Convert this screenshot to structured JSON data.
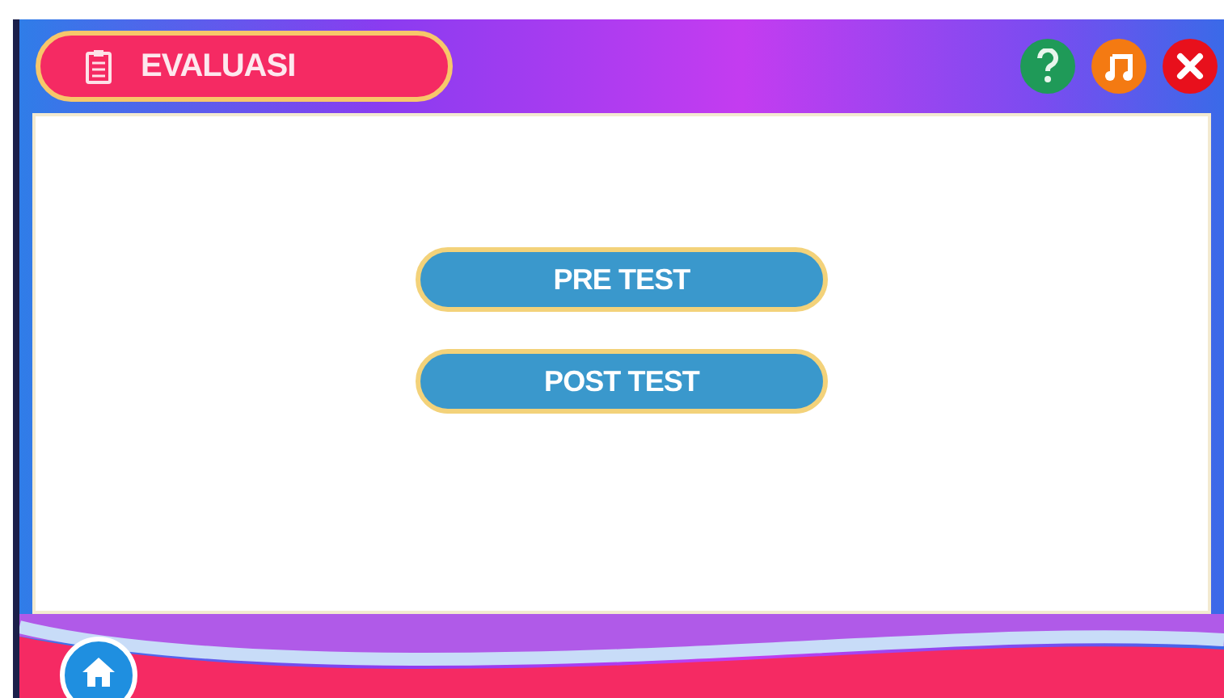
{
  "header": {
    "title": "EVALUASI"
  },
  "menu": {
    "buttons": [
      {
        "label": "PRE TEST"
      },
      {
        "label": "POST TEST"
      }
    ]
  }
}
